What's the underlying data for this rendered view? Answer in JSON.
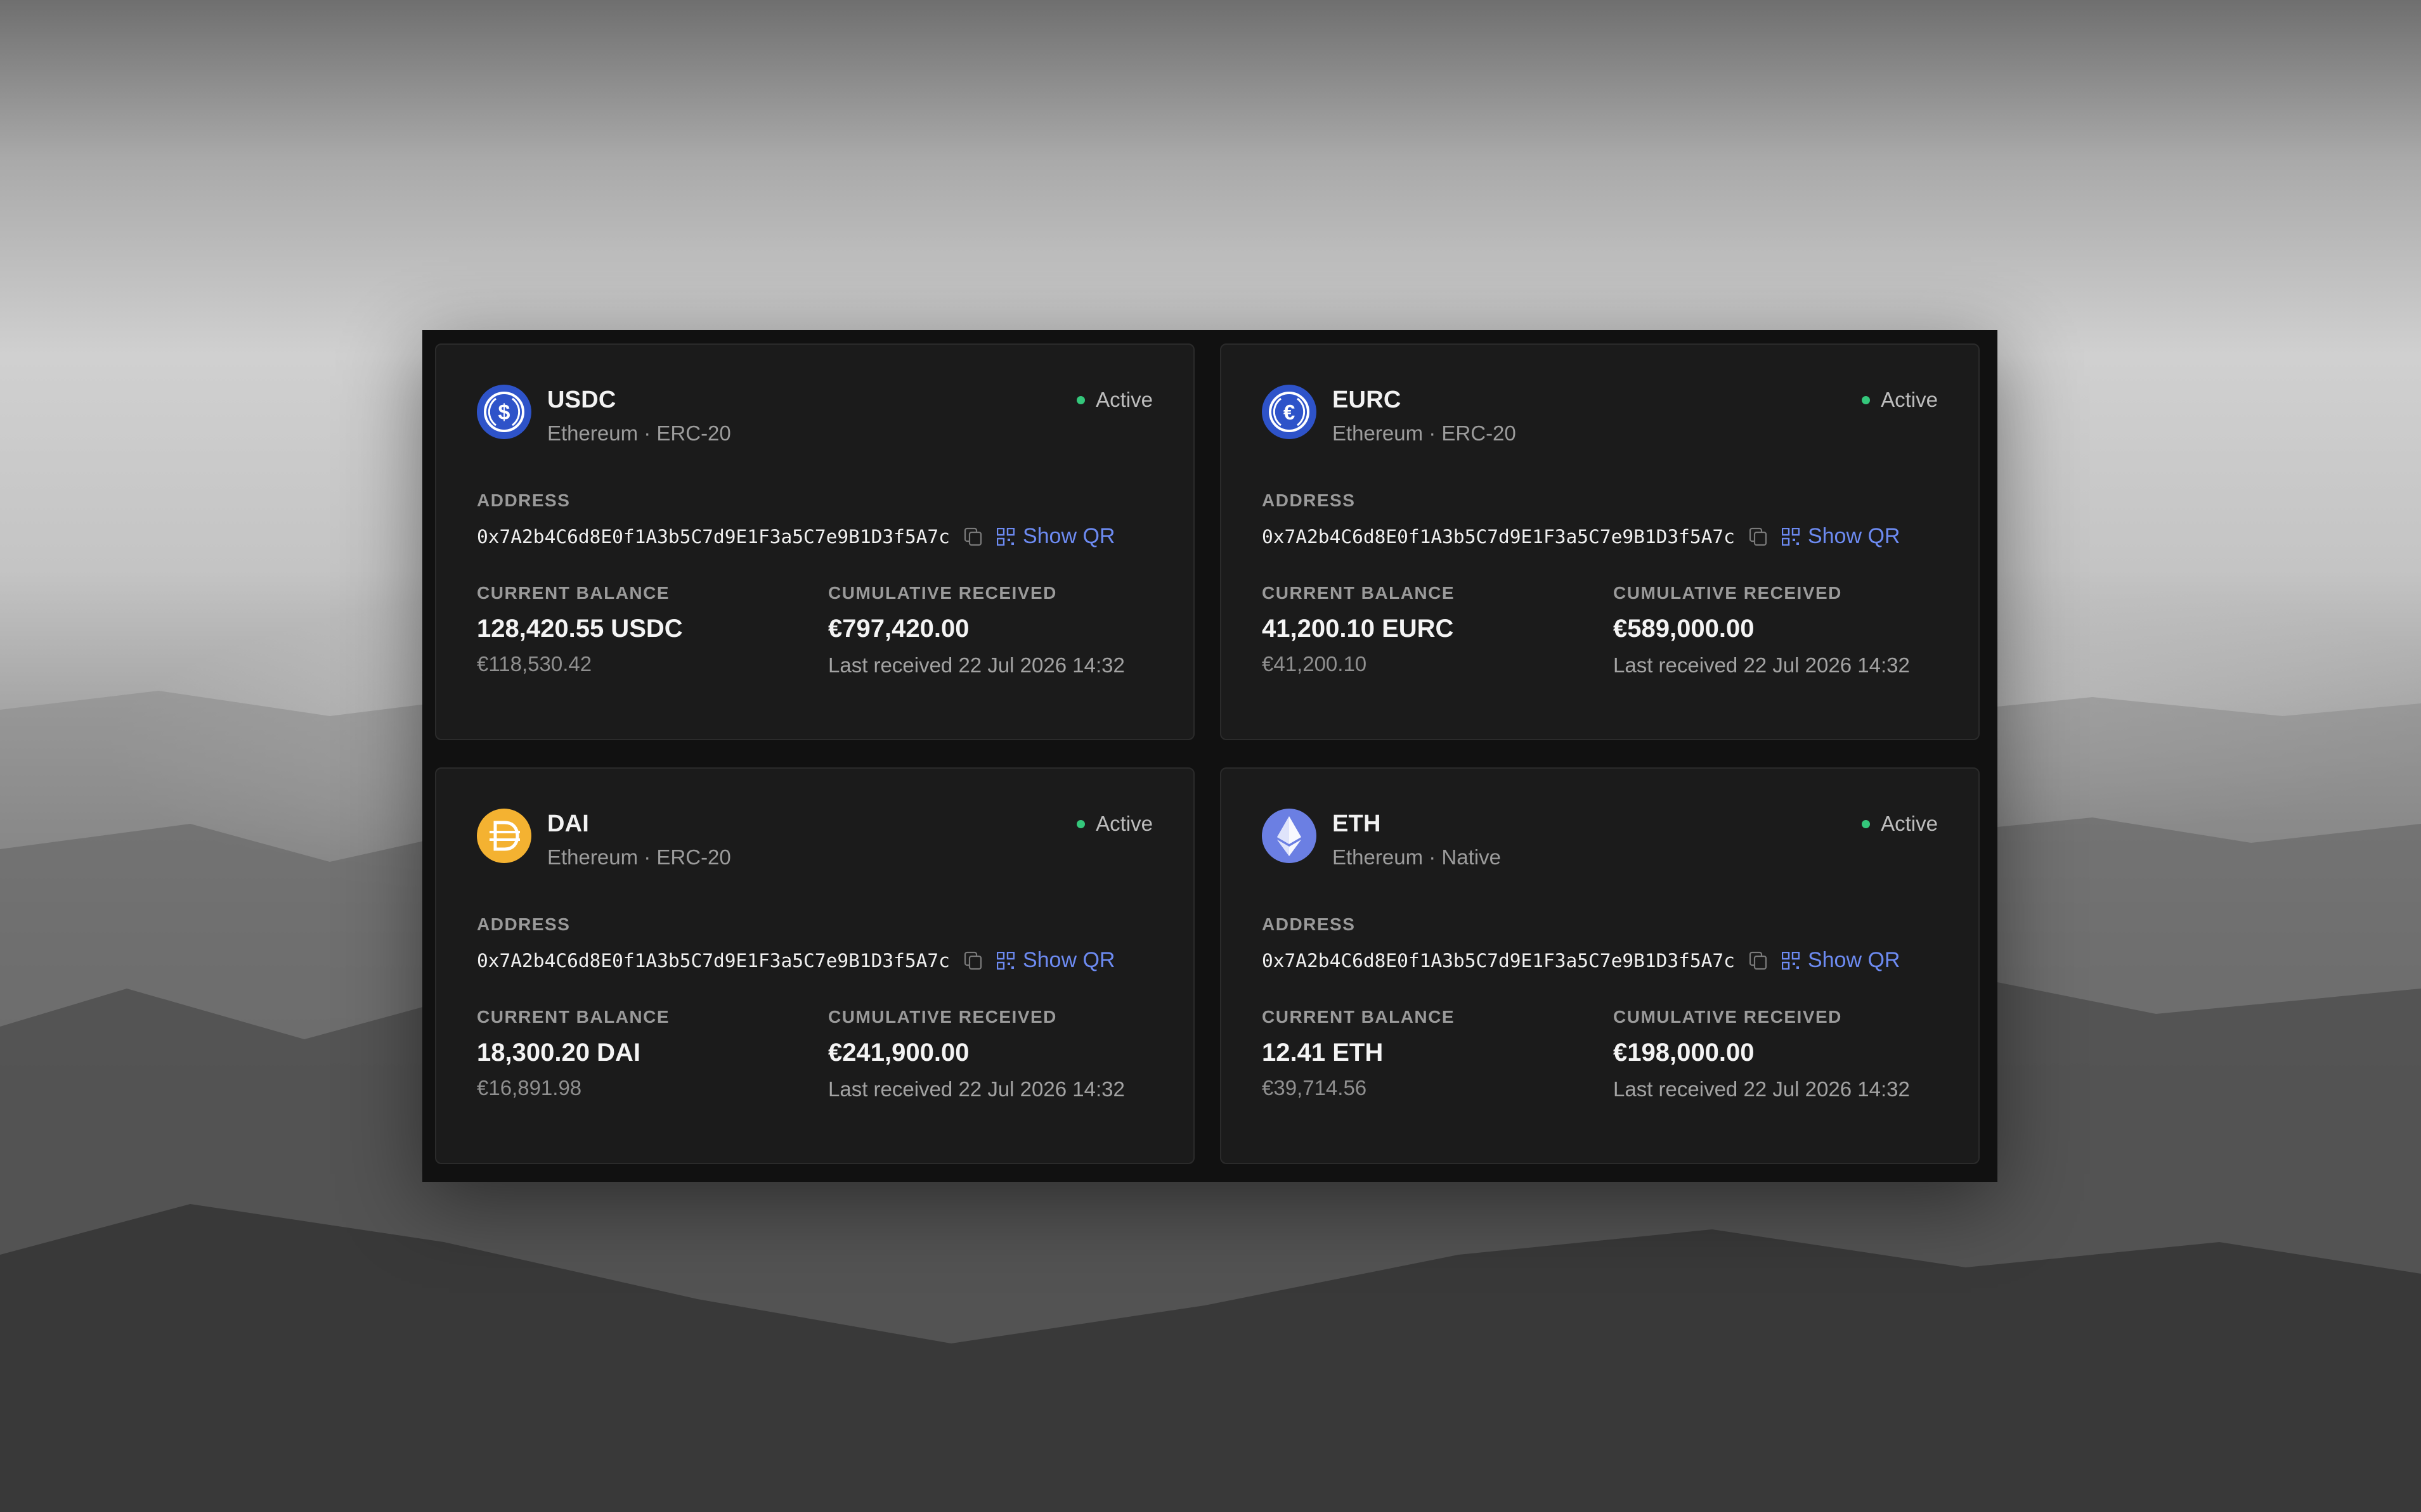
{
  "labels": {
    "address": "ADDRESS",
    "current_balance": "CURRENT BALANCE",
    "cumulative_received": "CUMULATIVE RECEIVED",
    "show_qr": "Show QR"
  },
  "colors": {
    "status_active": "#34c77b",
    "link": "#6d8bf2",
    "usdc": "#2e53c9",
    "eurc": "#2e53c9",
    "dai": "#f4b231",
    "eth": "#6b7fe3"
  },
  "wallets": [
    {
      "token": "USDC",
      "network": "Ethereum · ERC-20",
      "status": "Active",
      "icon": "usdc-icon",
      "address": "0x7A2b4C6d8E0f1A3b5C7d9E1F3a5C7e9B1D3f5A7c",
      "balance": "128,420.55 USDC",
      "balance_fiat": "€118,530.42",
      "cumulative": "€797,420.00",
      "last_received": "Last received 22 Jul 2026 14:32"
    },
    {
      "token": "EURC",
      "network": "Ethereum · ERC-20",
      "status": "Active",
      "icon": "eurc-icon",
      "address": "0x7A2b4C6d8E0f1A3b5C7d9E1F3a5C7e9B1D3f5A7c",
      "balance": "41,200.10 EURC",
      "balance_fiat": "€41,200.10",
      "cumulative": "€589,000.00",
      "last_received": "Last received 22 Jul 2026 14:32"
    },
    {
      "token": "DAI",
      "network": "Ethereum · ERC-20",
      "status": "Active",
      "icon": "dai-icon",
      "address": "0x7A2b4C6d8E0f1A3b5C7d9E1F3a5C7e9B1D3f5A7c",
      "balance": "18,300.20 DAI",
      "balance_fiat": "€16,891.98",
      "cumulative": "€241,900.00",
      "last_received": "Last received 22 Jul 2026 14:32"
    },
    {
      "token": "ETH",
      "network": "Ethereum · Native",
      "status": "Active",
      "icon": "eth-icon",
      "address": "0x7A2b4C6d8E0f1A3b5C7d9E1F3a5C7e9B1D3f5A7c",
      "balance": "12.41 ETH",
      "balance_fiat": "€39,714.56",
      "cumulative": "€198,000.00",
      "last_received": "Last received 22 Jul 2026 14:32"
    }
  ]
}
